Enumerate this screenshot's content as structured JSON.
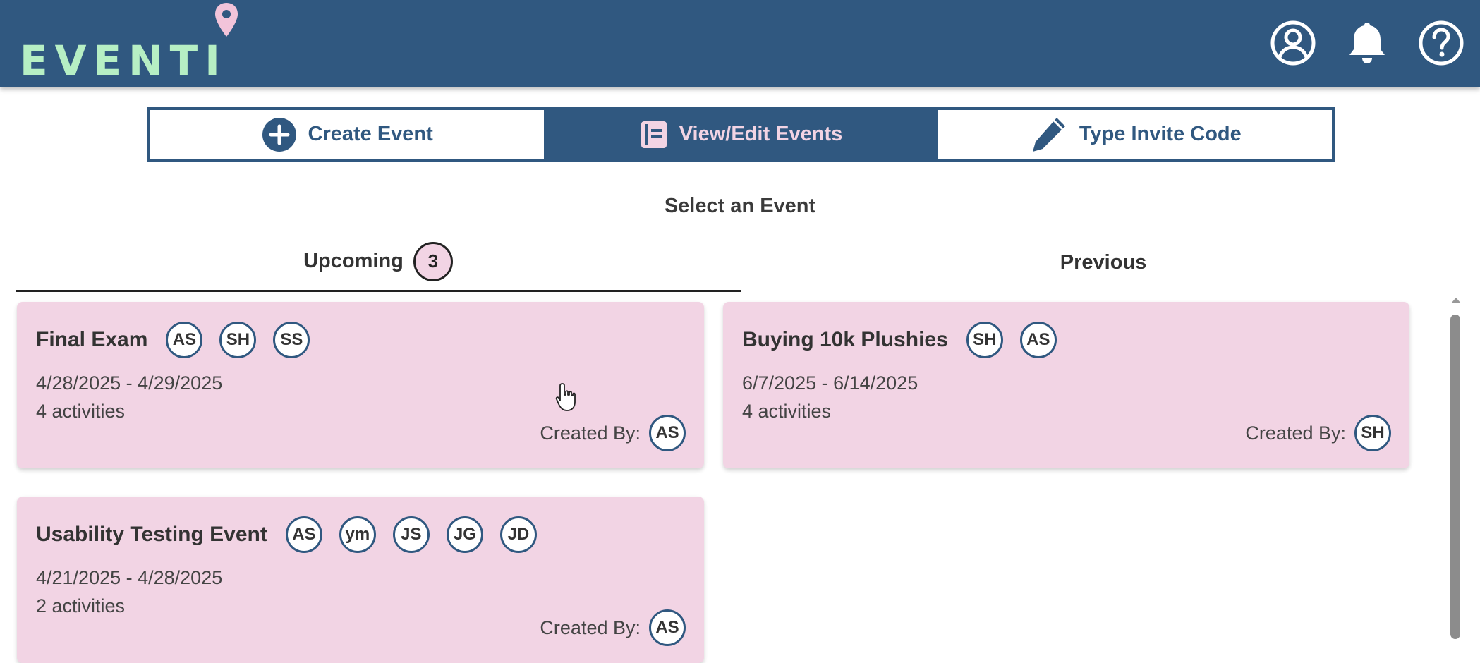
{
  "app": {
    "logo_text": "EVENTI",
    "colors": {
      "header": "#305880",
      "logo": "#b6efc4",
      "card": "#f2d4e4",
      "pin": "#f2c4da"
    }
  },
  "header_icons": [
    {
      "name": "account-icon"
    },
    {
      "name": "bell-icon"
    },
    {
      "name": "help-icon"
    }
  ],
  "segments": {
    "create": "Create Event",
    "view": "View/Edit Events",
    "invite": "Type Invite Code"
  },
  "select_title": "Select an Event",
  "tabs": {
    "upcoming": "Upcoming",
    "upcoming_count": "3",
    "previous": "Previous"
  },
  "events": [
    {
      "title": "Final Exam",
      "participants": [
        "AS",
        "SH",
        "SS"
      ],
      "dates": "4/28/2025 - 4/29/2025",
      "activities": "4 activities",
      "created_by_label": "Created By:",
      "creator": "AS"
    },
    {
      "title": "Buying 10k Plushies",
      "participants": [
        "SH",
        "AS"
      ],
      "dates": "6/7/2025 - 6/14/2025",
      "activities": "4 activities",
      "created_by_label": "Created By:",
      "creator": "SH"
    },
    {
      "title": "Usability Testing Event",
      "participants": [
        "AS",
        "ym",
        "JS",
        "JG",
        "JD"
      ],
      "dates": "4/21/2025 - 4/28/2025",
      "activities": "2 activities",
      "created_by_label": "Created By:",
      "creator": "AS"
    }
  ]
}
